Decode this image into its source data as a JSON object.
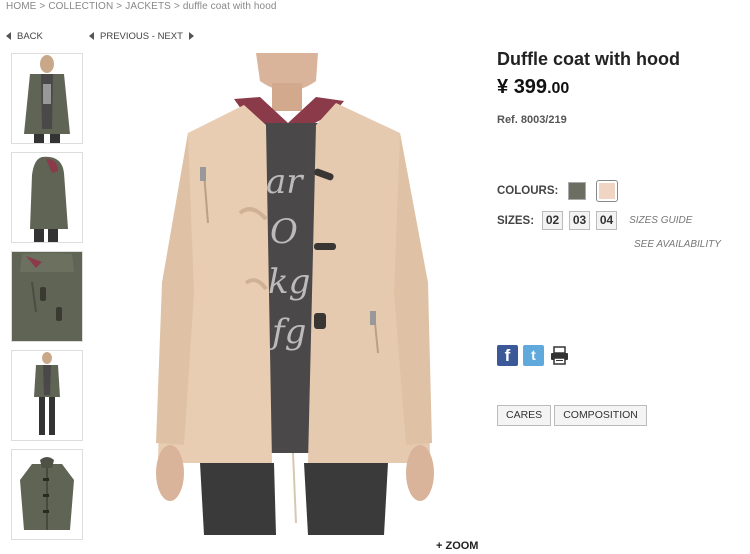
{
  "breadcrumb": {
    "items": [
      "HOME",
      "COLLECTION",
      "JACKETS",
      "duffle coat with hood"
    ],
    "separator": ">"
  },
  "nav": {
    "back_label": "BACK",
    "previous_label": "PREVIOUS",
    "next_label": "NEXT",
    "prevnext_dash": " - "
  },
  "product": {
    "title": "Duffle coat with hood",
    "currency": "¥",
    "price_whole": "399",
    "price_cents": ".00",
    "ref": "Ref. 8003/219"
  },
  "colours": {
    "label": "COLOURS:",
    "options": [
      {
        "name": "khaki",
        "hex": "#6b6e61",
        "selected": false
      },
      {
        "name": "beige",
        "hex": "#efd5c2",
        "selected": true
      }
    ]
  },
  "sizes": {
    "label": "SIZES:",
    "options": [
      "02",
      "03",
      "04"
    ],
    "guide_label": "SIZES GUIDE",
    "availability_label": "SEE AVAILABILITY"
  },
  "social": {
    "facebook_icon": "facebook-icon",
    "twitter_icon": "twitter-icon",
    "print_icon": "print-icon"
  },
  "tabs": {
    "cares_label": "CARES",
    "composition_label": "COMPOSITION"
  },
  "zoom_label": "+ ZOOM",
  "thumbnails": [
    "khaki-front",
    "khaki-side",
    "khaki-detail",
    "khaki-full",
    "khaki-flat"
  ],
  "colors": {
    "coat_beige": "#e8cdb3",
    "coat_khaki": "#5f6454",
    "shirt_gray": "#4a4848"
  }
}
